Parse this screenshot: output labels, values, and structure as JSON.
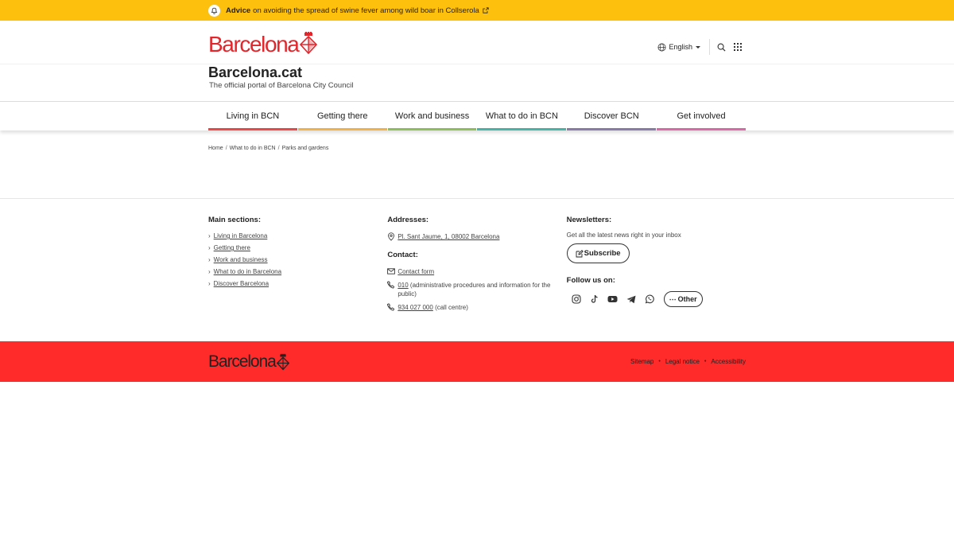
{
  "alert": {
    "strong": "Advice",
    "text": "on avoiding the spread of swine fever among wild boar in Collserola",
    "icon": "bell-icon",
    "link_icon": "external-link-icon"
  },
  "header": {
    "logo_text": "Barcelona",
    "site_title": "Barcelona.cat",
    "site_subtitle": "The official portal of Barcelona City Council",
    "language": "English"
  },
  "nav": {
    "items": [
      {
        "label": "Living in BCN",
        "color": "#e84a4a"
      },
      {
        "label": "Getting there",
        "color": "#f0b24a"
      },
      {
        "label": "Work and business",
        "color": "#8fbf5a"
      },
      {
        "label": "What to do in BCN",
        "color": "#4ab3a8"
      },
      {
        "label": "Discover BCN",
        "color": "#8a7aa8"
      },
      {
        "label": "Get involved",
        "color": "#d86aa8"
      }
    ]
  },
  "breadcrumb": {
    "items": [
      "Home",
      "What to do in BCN",
      "Parks and gardens"
    ],
    "separator": "/"
  },
  "footer": {
    "main_title": "Main sections:",
    "main_links": [
      "Living in Barcelona",
      "Getting there",
      "Work and business",
      "What to do in Barcelona",
      "Discover Barcelona"
    ],
    "addresses_title": "Addresses:",
    "address": "Pl. Sant Jaume, 1, 08002 Barcelona",
    "contact_title": "Contact:",
    "contact_form": "Contact form",
    "phone1_link": "010",
    "phone1_text": "(administrative procedures and information for the public)",
    "phone2_link": "934 027 000",
    "phone2_text": "(call centre)",
    "newsletters_title": "Newsletters:",
    "newsletters_text": "Get all the latest news right in your inbox",
    "subscribe": "Subscribe",
    "follow_title": "Follow us on:",
    "other": "Other"
  },
  "bottom": {
    "logo_text": "Barcelona",
    "links": [
      "Sitemap",
      "Legal notice",
      "Accessibility"
    ]
  },
  "colors": {
    "alert_bg": "#fdc10d",
    "brand_red": "#e3262b",
    "footer_red": "#ff2a2a"
  }
}
